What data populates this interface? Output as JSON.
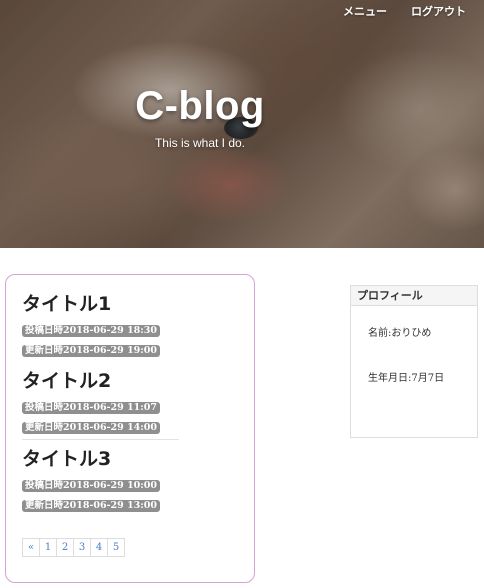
{
  "nav": {
    "menu_label": "メニュー",
    "logout_label": "ログアウト"
  },
  "hero": {
    "title": "C-blog",
    "subtitle": "This is what I do."
  },
  "posts": [
    {
      "title": "タイトル1",
      "posted": "投稿日時2018-06-29 18:30",
      "updated": "更新日時2018-06-29 19:00"
    },
    {
      "title": "タイトル2",
      "posted": "投稿日時2018-06-29 11:07",
      "updated": "更新日時2018-06-29 14:00"
    },
    {
      "title": "タイトル3",
      "posted": "投稿日時2018-06-29 10:00",
      "updated": "更新日時2018-06-29 13:00"
    }
  ],
  "pagination": {
    "prev": "«",
    "pages": [
      "1",
      "2",
      "3",
      "4",
      "5"
    ]
  },
  "profile": {
    "heading": "プロフィール",
    "name": "名前:おりひめ",
    "birthday": "生年月日:7月7日"
  },
  "colors": {
    "card_border": "#d7a2d4",
    "badge_bg": "#8f8f8f",
    "link": "#4a7ec8"
  }
}
